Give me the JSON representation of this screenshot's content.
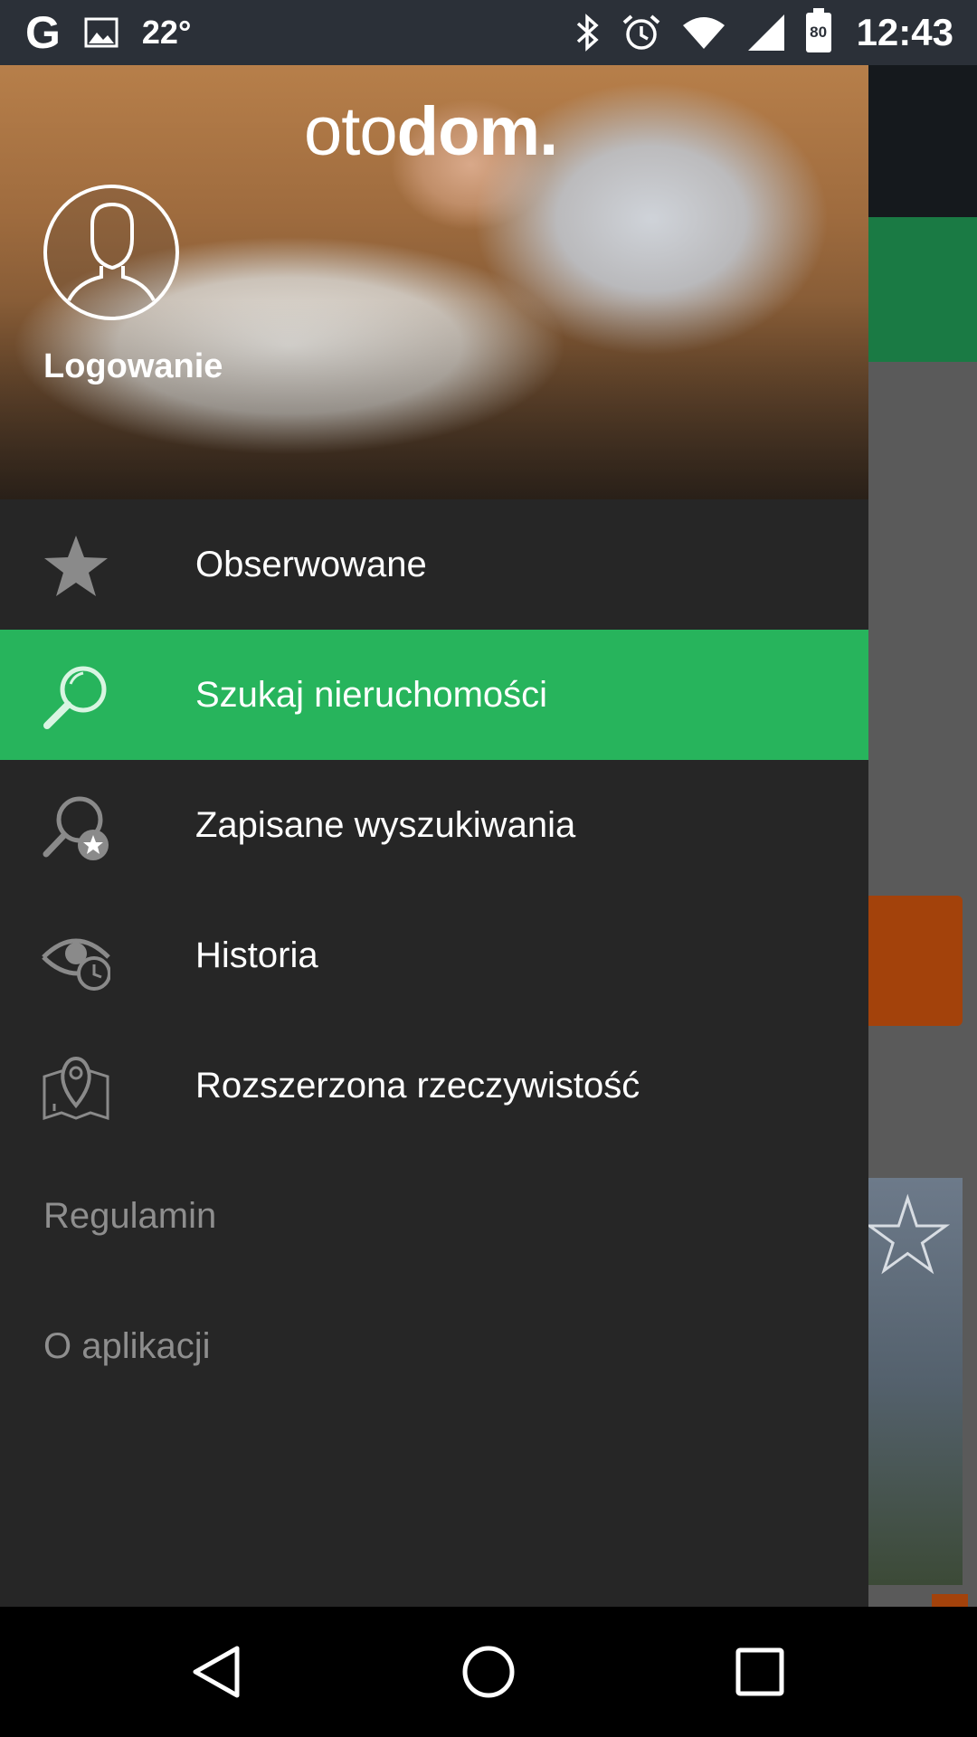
{
  "status_bar": {
    "left_icons": [
      "google-icon",
      "image-icon"
    ],
    "g_label": "G",
    "temperature": "22°",
    "right_icons": [
      "bluetooth-icon",
      "alarm-icon",
      "wifi-icon",
      "signal-icon",
      "battery-icon"
    ],
    "battery_level": "80",
    "time": "12:43"
  },
  "drawer": {
    "logo": {
      "light_part": "oto",
      "bold_part": "dom."
    },
    "login_label": "Logowanie",
    "menu": [
      {
        "label": "Obserwowane",
        "icon": "star-icon",
        "active": false
      },
      {
        "label": "Szukaj nieruchomości",
        "icon": "search-icon",
        "active": true
      },
      {
        "label": "Zapisane wyszukiwania",
        "icon": "saved-search-icon",
        "active": false
      },
      {
        "label": "Historia",
        "icon": "history-eye-icon",
        "active": false
      },
      {
        "label": "Rozszerzona rzeczywistość",
        "icon": "map-pin-icon",
        "active": false
      }
    ],
    "footer": [
      {
        "label": "Regulamin"
      },
      {
        "label": "O aplikacji"
      }
    ]
  },
  "colors": {
    "accent_green": "#27b45c",
    "drawer_bg": "#262626",
    "status_bar_bg": "#2b3038",
    "muted_text": "#8e8e8e"
  },
  "nav_bar": {
    "buttons": [
      "back-icon",
      "home-icon",
      "recents-icon"
    ]
  }
}
